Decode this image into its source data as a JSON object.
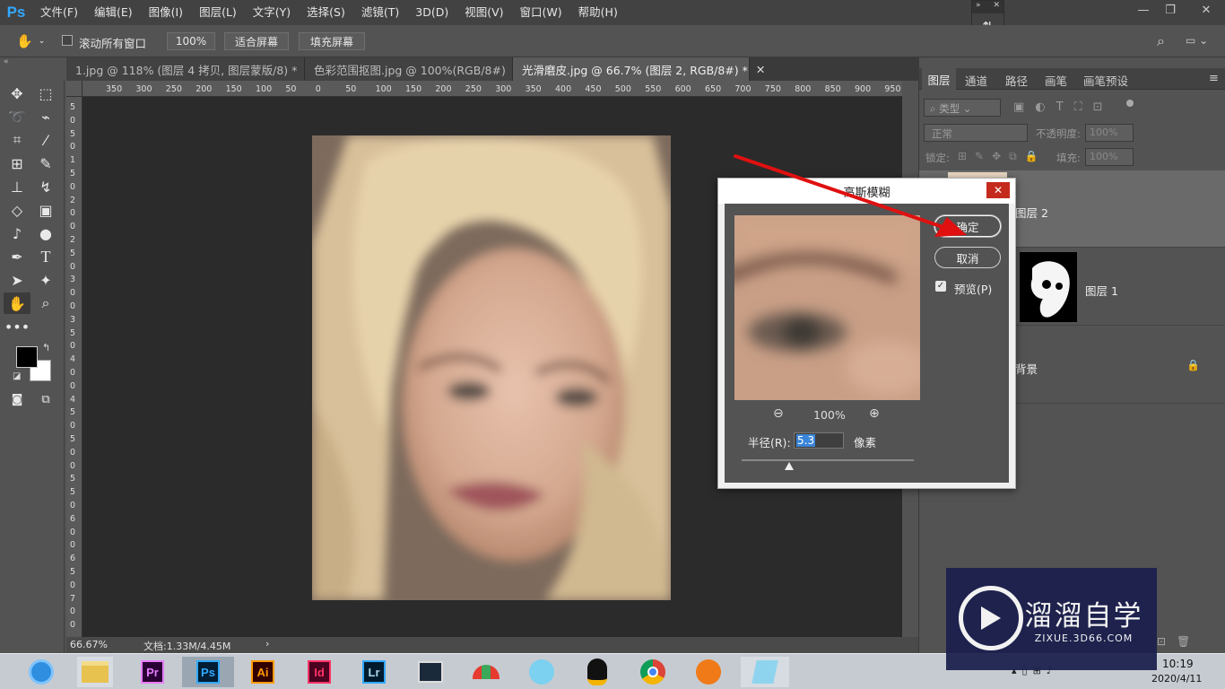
{
  "app": {
    "logo": "Ps"
  },
  "menu": [
    "文件(F)",
    "编辑(E)",
    "图像(I)",
    "图层(L)",
    "文字(Y)",
    "选择(S)",
    "滤镜(T)",
    "3D(D)",
    "视图(V)",
    "窗口(W)",
    "帮助(H)"
  ],
  "options": {
    "scroll_all_label": "滚动所有窗口",
    "zoom_btn": "100%",
    "fit_screen": "适合屏幕",
    "fill_screen": "填充屏幕"
  },
  "tabs": [
    {
      "label": "1.jpg @ 118% (图层 4 拷贝, 图层蒙版/8) *",
      "active": false
    },
    {
      "label": "色彩范围抠图.jpg @ 100%(RGB/8#)",
      "active": false
    },
    {
      "label": "光滑磨皮.jpg @ 66.7% (图层 2, RGB/8#) *",
      "active": true
    }
  ],
  "ruler": {
    "h": [
      "350",
      "300",
      "250",
      "200",
      "150",
      "100",
      "50",
      "0",
      "50",
      "100",
      "150",
      "200",
      "250",
      "300",
      "350",
      "400",
      "450",
      "500",
      "550",
      "600",
      "650",
      "700",
      "750",
      "800",
      "850",
      "900",
      "950"
    ],
    "v": [
      "5",
      "0",
      "5",
      "0",
      "1",
      "5",
      "0",
      "2",
      "0",
      "0",
      "2",
      "5",
      "0",
      "3",
      "0",
      "0",
      "3",
      "5",
      "0",
      "4",
      "0",
      "0",
      "4",
      "5",
      "0",
      "5",
      "0",
      "0",
      "5",
      "5",
      "0",
      "6",
      "0",
      "0",
      "6",
      "5",
      "0",
      "7",
      "0",
      "0"
    ]
  },
  "status": {
    "zoom": "66.67%",
    "doc": "文档:1.33M/4.45M",
    "arrow": "›"
  },
  "panel": {
    "tabs": [
      "图层",
      "通道",
      "路径",
      "画笔",
      "画笔预设"
    ],
    "kind_filter": "类型",
    "blend_mode": "正常",
    "opacity_label": "不透明度:",
    "opacity_value": "100%",
    "lock_label": "锁定:",
    "fill_label": "填充:",
    "fill_value": "100%",
    "layers": [
      {
        "name": "图层 2",
        "selected": true
      },
      {
        "name": "图层 1",
        "selected": false
      },
      {
        "name": "背景",
        "selected": false
      }
    ]
  },
  "dialog": {
    "title": "高斯模糊",
    "ok": "确定",
    "cancel": "取消",
    "preview_label": "预览(P)",
    "preview_checked": true,
    "zoom_level": "100%",
    "radius_label": "半径(R):",
    "radius_value": "5.3",
    "radius_unit": "像素"
  },
  "taskbar": {
    "apps": [
      "Pr",
      "Ps",
      "Ai",
      "Id",
      "Lr"
    ],
    "time": "10:19",
    "date": "2020/4/11"
  },
  "watermark": {
    "brand": "溜溜自学",
    "url": "ZIXUE.3D66.COM"
  },
  "colors": {
    "accent_red": "#e01010",
    "ps_blue": "#31a8ff"
  }
}
